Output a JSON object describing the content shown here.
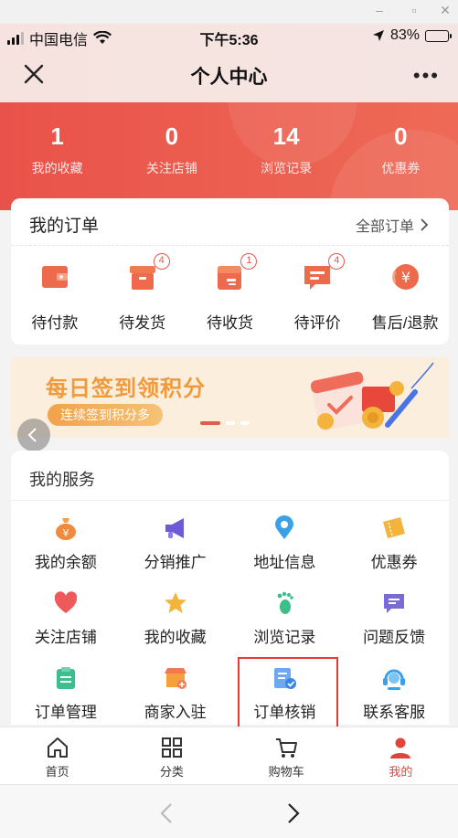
{
  "status": {
    "carrier": "中国电信",
    "time": "下午5:36",
    "battery": "83%",
    "battery_level": 0.83
  },
  "nav": {
    "title": "个人中心"
  },
  "stats": [
    {
      "num": "1",
      "label": "我的收藏"
    },
    {
      "num": "0",
      "label": "关注店铺"
    },
    {
      "num": "14",
      "label": "浏览记录"
    },
    {
      "num": "0",
      "label": "优惠券"
    }
  ],
  "orders": {
    "title": "我的订单",
    "all_label": "全部订单",
    "items": [
      {
        "label": "待付款",
        "icon": "wallet-icon",
        "badge": ""
      },
      {
        "label": "待发货",
        "icon": "package-icon",
        "badge": "4"
      },
      {
        "label": "待收货",
        "icon": "box-icon",
        "badge": "1"
      },
      {
        "label": "待评价",
        "icon": "comment-icon",
        "badge": "4"
      },
      {
        "label": "售后/退款",
        "icon": "refund-icon",
        "badge": ""
      }
    ]
  },
  "banner": {
    "title": "每日签到领积分",
    "subtitle": "连续签到积分多"
  },
  "services": {
    "title": "我的服务",
    "items": [
      {
        "label": "我的余额",
        "icon": "money-bag-icon"
      },
      {
        "label": "分销推广",
        "icon": "megaphone-icon"
      },
      {
        "label": "地址信息",
        "icon": "location-pin-icon"
      },
      {
        "label": "优惠券",
        "icon": "coupon-icon"
      },
      {
        "label": "关注店铺",
        "icon": "heart-icon"
      },
      {
        "label": "我的收藏",
        "icon": "star-icon"
      },
      {
        "label": "浏览记录",
        "icon": "footprint-icon"
      },
      {
        "label": "问题反馈",
        "icon": "feedback-icon"
      },
      {
        "label": "订单管理",
        "icon": "clipboard-icon"
      },
      {
        "label": "商家入驻",
        "icon": "shop-icon"
      },
      {
        "label": "订单核销",
        "icon": "verify-order-icon"
      },
      {
        "label": "联系客服",
        "icon": "headset-icon"
      }
    ]
  },
  "tabs": [
    {
      "label": "首页",
      "icon": "home-icon",
      "active": false
    },
    {
      "label": "分类",
      "icon": "grid-icon",
      "active": false
    },
    {
      "label": "购物车",
      "icon": "cart-icon",
      "active": false
    },
    {
      "label": "我的",
      "icon": "user-icon",
      "active": true
    }
  ],
  "colors": {
    "accent": "#e9524a",
    "active_tab": "#e0453c",
    "banner_text": "#f09a3c",
    "highlight_box": "#e53b37"
  }
}
